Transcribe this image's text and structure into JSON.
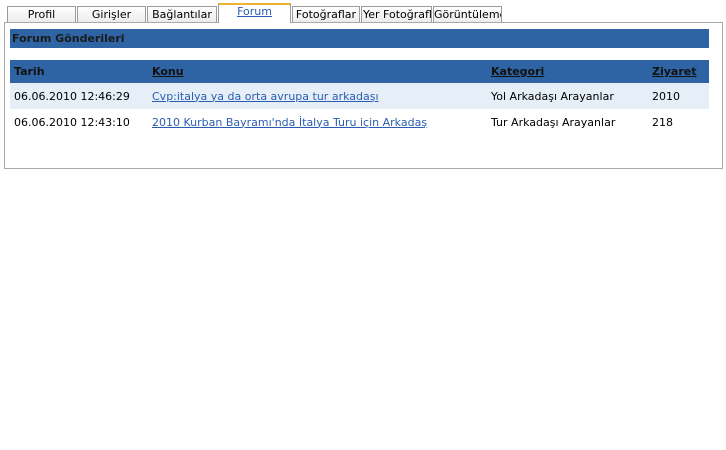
{
  "tabs": [
    {
      "label": "Profil"
    },
    {
      "label": "Girişler"
    },
    {
      "label": "Bağlantılar"
    },
    {
      "label": "Forum",
      "active": true
    },
    {
      "label": "Fotoğraflar"
    },
    {
      "label": "Yer Fotoğrafları"
    },
    {
      "label": "Görüntüleme"
    }
  ],
  "section": {
    "title": "Forum Gönderileri"
  },
  "table": {
    "headers": {
      "date": "Tarih",
      "topic": "Konu",
      "category": "Kategori",
      "visits": "Ziyaret"
    },
    "rows": [
      {
        "date": "06.06.2010 12:46:29",
        "topic": "Cvp:italya ya da orta avrupa tur arkadaşı",
        "category": "Yol Arkadaşı Arayanlar",
        "visits": "2010"
      },
      {
        "date": "06.06.2010 12:43:10",
        "topic": "2010 Kurban Bayramı'nda İtalya Turu için Arkadaş",
        "category": "Tur Arkadaşı Arayanlar",
        "visits": "218"
      }
    ]
  },
  "colors": {
    "header_bg": "#2e64a4",
    "link": "#2a5db0",
    "active_tab_border": "#f0b030",
    "alt_row": "#e6eef8"
  }
}
